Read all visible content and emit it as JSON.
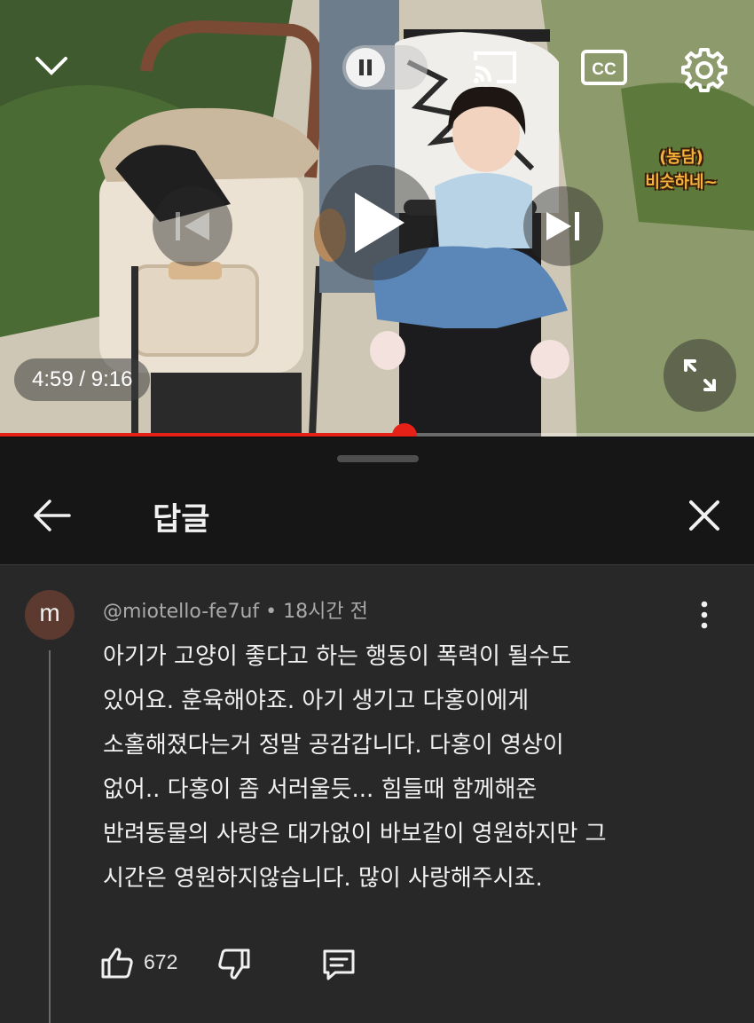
{
  "player": {
    "time_display": "4:59 / 9:16",
    "progress_fraction": 0.537,
    "overlay_caption_line1": "(농담)",
    "overlay_caption_line2": "비슷하네~",
    "accent_color": "#e62117"
  },
  "panel": {
    "title": "답글",
    "back_icon": "arrow-left-icon",
    "close_icon": "close-icon"
  },
  "comment": {
    "avatar_letter": "m",
    "author": "@miotello-fe7uf",
    "separator": " • ",
    "time_ago": "18시간 전",
    "lines": [
      "아기가 고양이 좋다고 하는 행동이 폭력이 될수도",
      "있어요. 훈육해야죠. 아기 생기고 다홍이에게",
      "소홀해졌다는거 정말 공감갑니다. 다홍이 영상이",
      "없어.. 다홍이 좀 서러울듯... 힘들때 함께해준",
      "반려동물의 사랑은 대가없이 바보같이 영원하지만 그",
      "시간은 영원하지않습니다. 많이 사랑해주시죠."
    ],
    "like_count": "672"
  }
}
